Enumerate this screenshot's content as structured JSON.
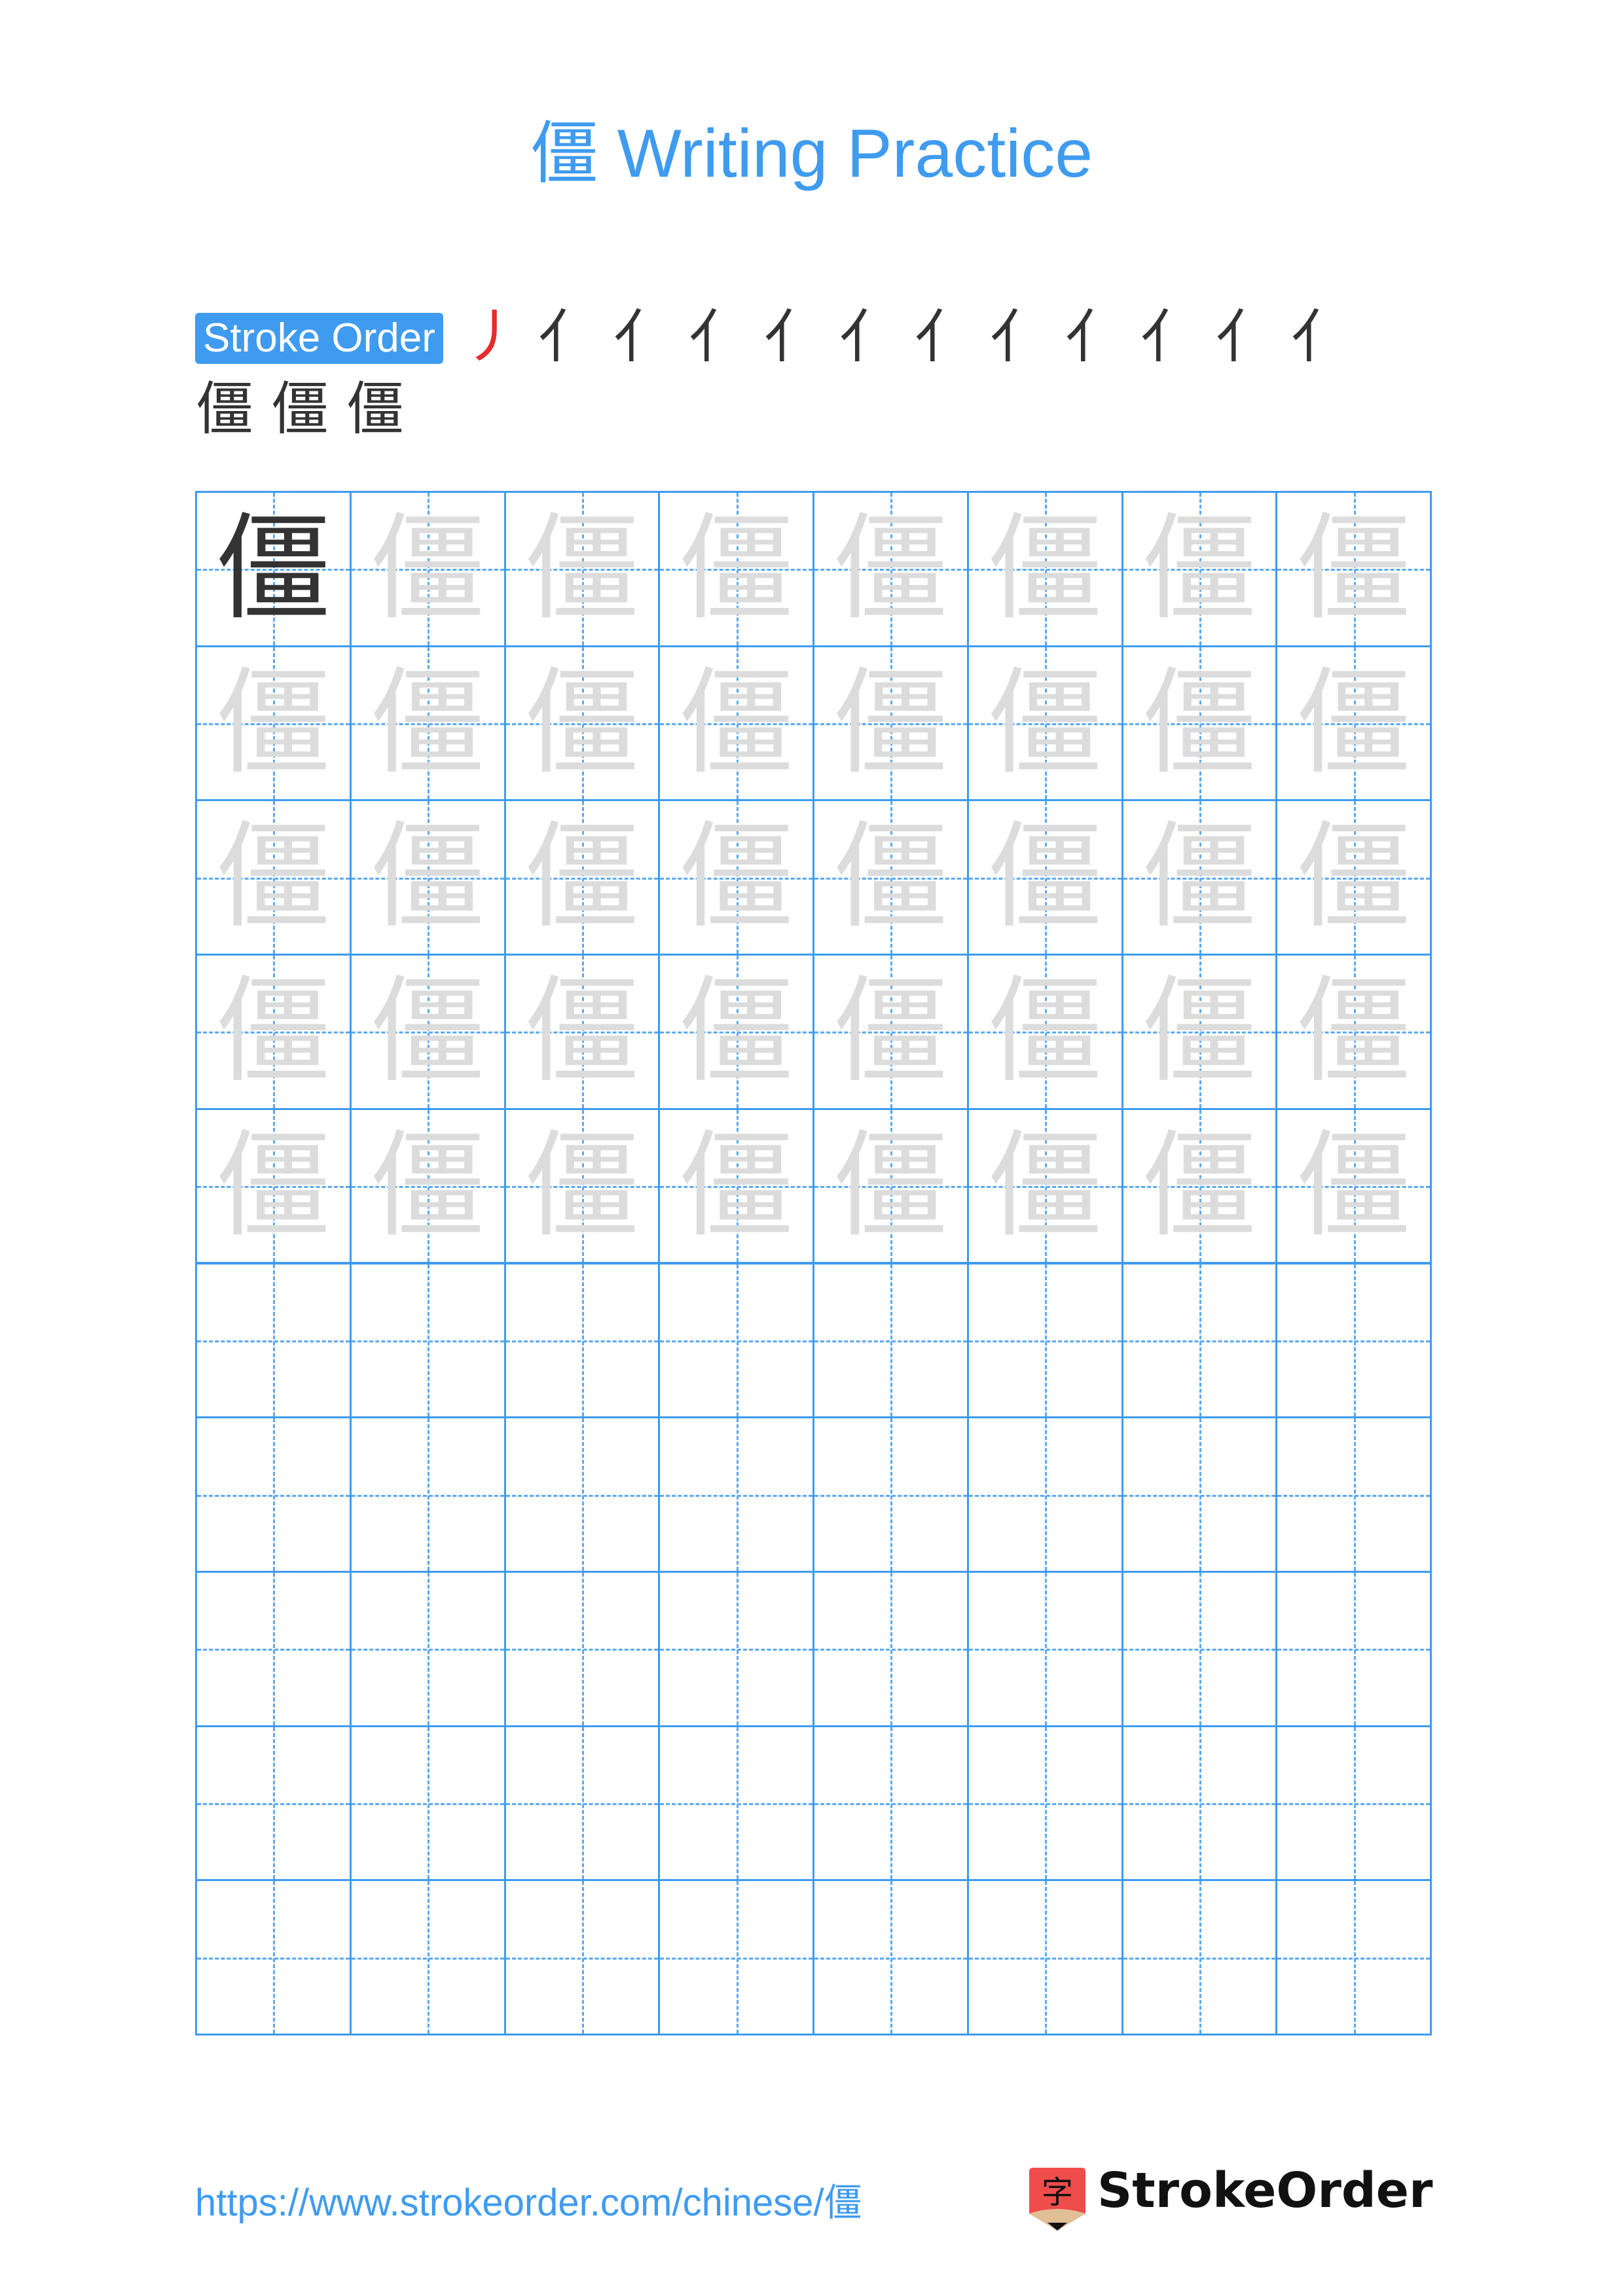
{
  "character": "僵",
  "header": {
    "title": "僵 Writing Practice"
  },
  "stroke_order": {
    "label": "Stroke Order",
    "steps": [
      {
        "glyph": "丿"
      },
      {
        "glyph": "亻"
      },
      {
        "glyph": "亻"
      },
      {
        "glyph": "亻"
      },
      {
        "glyph": "亻"
      },
      {
        "glyph": "亻"
      },
      {
        "glyph": "亻"
      },
      {
        "glyph": "亻"
      },
      {
        "glyph": "亻"
      },
      {
        "glyph": "亻"
      },
      {
        "glyph": "亻"
      },
      {
        "glyph": "亻"
      },
      {
        "glyph": "僵"
      },
      {
        "glyph": "僵"
      },
      {
        "glyph": "僵"
      }
    ],
    "total_steps": 15
  },
  "practice_grid": {
    "rows": 10,
    "cols": 8,
    "model_cells": 1,
    "trace_rows": 5,
    "blank_rows": 5,
    "colors": {
      "grid": "#3f9bf0",
      "trace": "#dcdcdc",
      "model": "#333333",
      "highlight": "#e52b2b"
    }
  },
  "footer": {
    "url": "https://www.strokeorder.com/chinese/僵",
    "logo_text": "StrokeOrder",
    "logo_glyph": "字"
  }
}
